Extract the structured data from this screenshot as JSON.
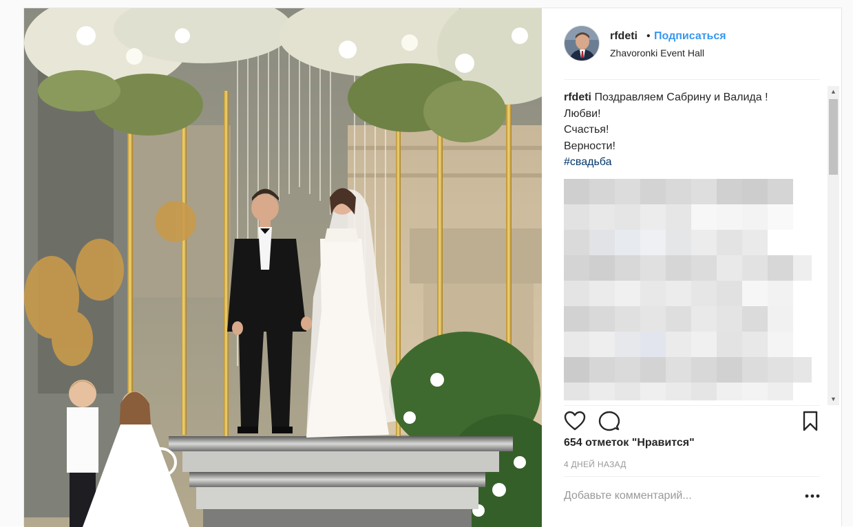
{
  "post": {
    "username": "rfdeti",
    "separator": "•",
    "follow_label": "Подписаться",
    "location": "Zhavoronki Event Hall",
    "caption": {
      "username": "rfdeti",
      "line1": "Поздравляем Сабрину и Валида !",
      "line2": "Любви!",
      "line3": "Счастья!",
      "line4": "Верности!",
      "hashtag": "#свадьба"
    },
    "likes_text": "654 отметок \"Нравится\"",
    "date_text": "4 дней назад",
    "comment_placeholder": "Добавьте комментарий..."
  },
  "icons": {
    "like": "heart-icon",
    "comment": "comment-bubble-icon",
    "save": "bookmark-icon",
    "more": "more-options-icon"
  },
  "colors": {
    "link_blue": "#3897f0",
    "hashtag": "#003569",
    "muted": "#999999",
    "text": "#262626"
  }
}
